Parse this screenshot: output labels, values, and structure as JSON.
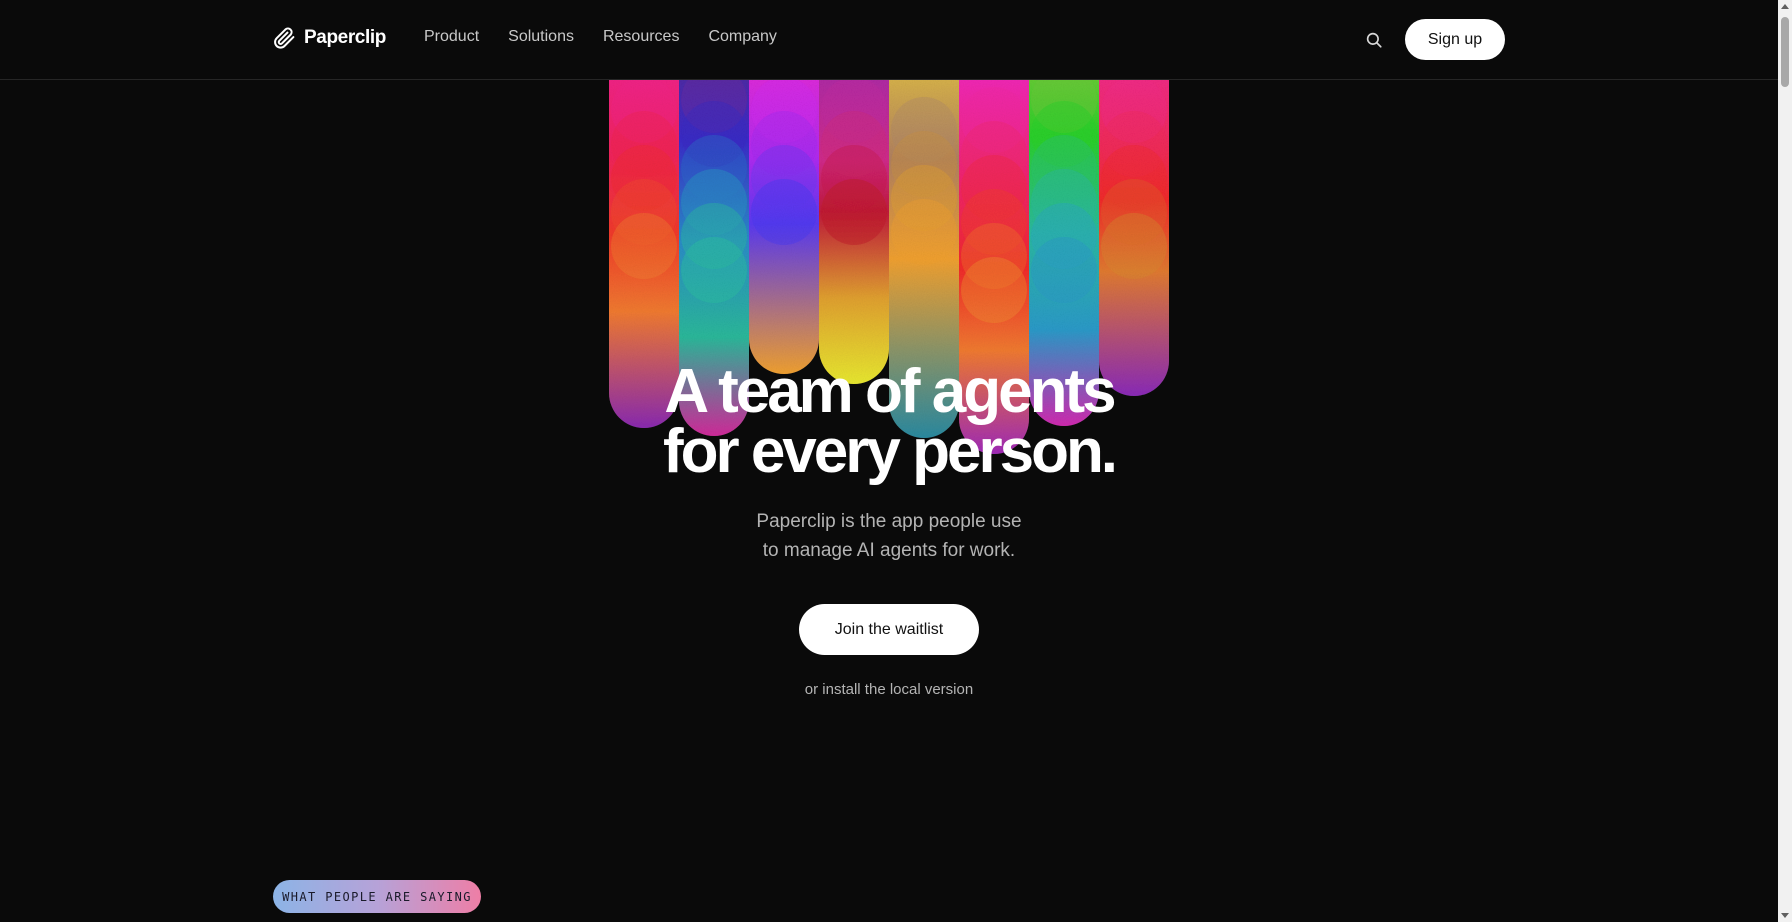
{
  "header": {
    "logo_text": "Paperclip",
    "nav": [
      {
        "label": "Product"
      },
      {
        "label": "Solutions"
      },
      {
        "label": "Resources"
      },
      {
        "label": "Company"
      }
    ],
    "search_icon": "search-icon",
    "signup_label": "Sign up"
  },
  "hero": {
    "title_line1": "A team of agents",
    "title_line2": "for every person.",
    "subtitle_line1": "Paperclip is the app people use",
    "subtitle_line2": "to manage AI agents for work.",
    "cta_label": "Join the waitlist",
    "install_link": "or install the local version"
  },
  "testimonials": {
    "badge_label": "WHAT PEOPLE ARE SAYING"
  },
  "colors": {
    "background": "#0a0a0a",
    "button_bg": "#ffffff",
    "muted_text": "#b4b4b4",
    "badge_gradient_start": "#8cb4e6",
    "badge_gradient_end": "#ee7ea6"
  }
}
